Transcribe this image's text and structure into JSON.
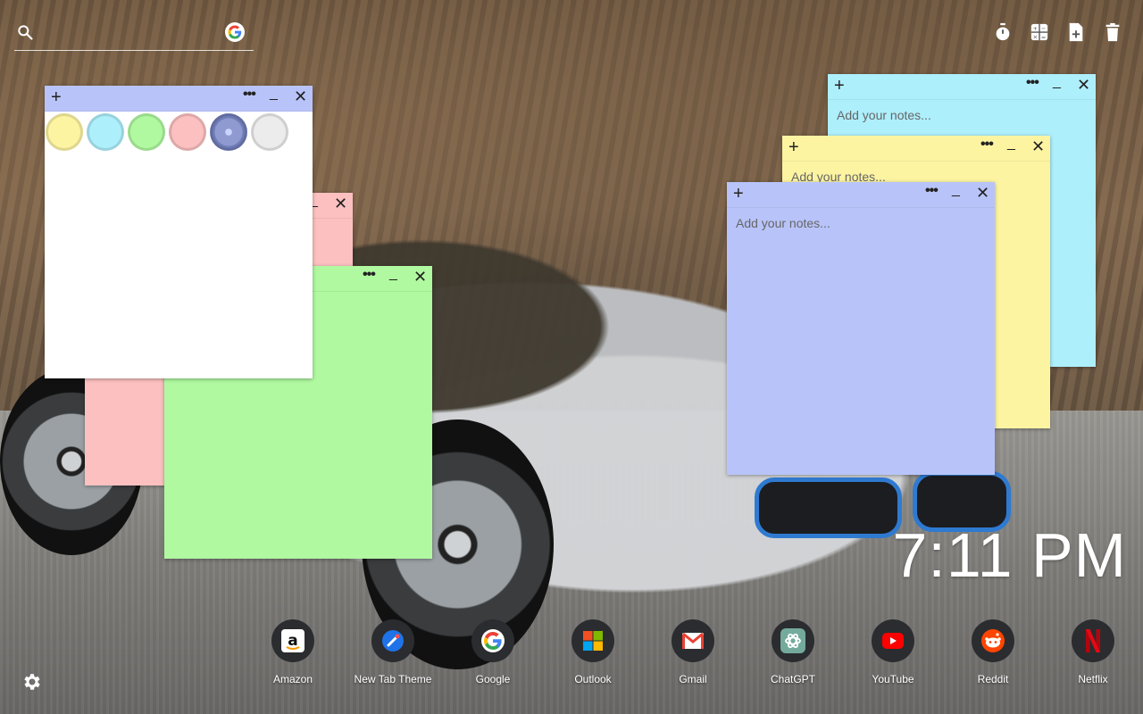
{
  "search": {
    "placeholder": "",
    "engine_icon": "google-g-icon"
  },
  "toolbar": {
    "items": [
      {
        "icon": "stopwatch-icon"
      },
      {
        "icon": "calculator-icon"
      },
      {
        "icon": "new-note-icon"
      },
      {
        "icon": "trash-icon"
      }
    ]
  },
  "notes": [
    {
      "id": "cyan",
      "color": "#aeeffc",
      "placeholder": "Add your notes..."
    },
    {
      "id": "yellow",
      "color": "#fdf4a2",
      "placeholder": "Add your notes..."
    },
    {
      "id": "blue",
      "color": "#b8c4f9",
      "placeholder": "Add your notes..."
    },
    {
      "id": "pink",
      "color": "#fcc0c0"
    },
    {
      "id": "green",
      "color": "#b0f9a0"
    },
    {
      "id": "white",
      "color": "#ffffff",
      "header_color": "#b8c4f9",
      "swatches": [
        "#fdf4a2",
        "#aeeffc",
        "#b0f9a0",
        "#fcc0c0",
        "#8e9ad0",
        "#ececec"
      ]
    }
  ],
  "header_icons": {
    "add": "+",
    "more": "•••",
    "minimize": "_",
    "close": "✕"
  },
  "clock": {
    "time": "7:11 PM"
  },
  "shortcuts": [
    {
      "label": "Amazon",
      "icon": "amazon-icon"
    },
    {
      "label": "New Tab Theme",
      "icon": "new-tab-theme-icon"
    },
    {
      "label": "Google",
      "icon": "google-icon"
    },
    {
      "label": "Outlook",
      "icon": "outlook-icon"
    },
    {
      "label": "Gmail",
      "icon": "gmail-icon"
    },
    {
      "label": "ChatGPT",
      "icon": "chatgpt-icon"
    },
    {
      "label": "YouTube",
      "icon": "youtube-icon"
    },
    {
      "label": "Reddit",
      "icon": "reddit-icon"
    },
    {
      "label": "Netflix",
      "icon": "netflix-icon"
    }
  ],
  "settings": {
    "icon": "gear-icon"
  }
}
